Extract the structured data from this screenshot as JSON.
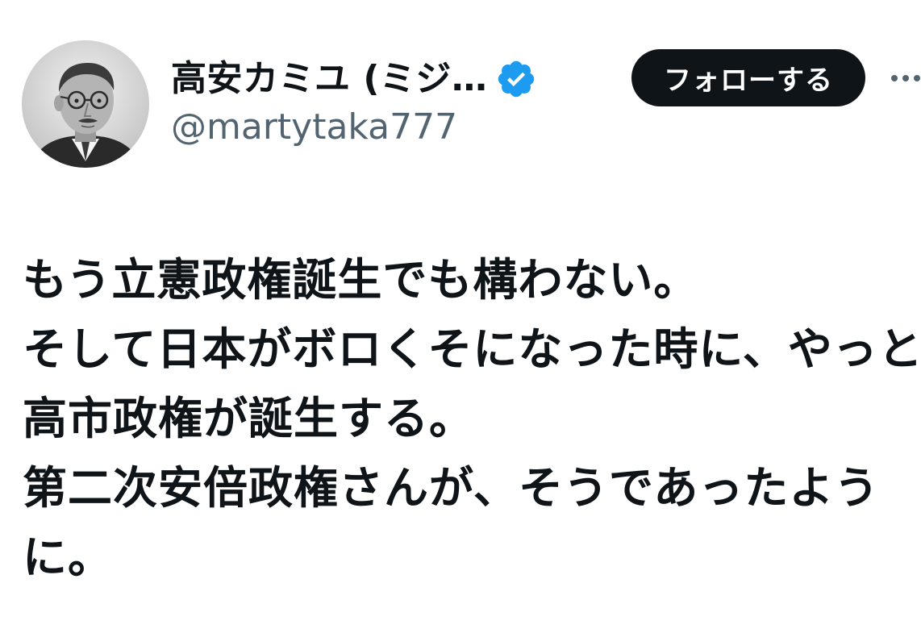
{
  "tweet": {
    "author": {
      "display_name": "高安カミユ (ミジ…",
      "handle": "@martytaka777",
      "verified": true,
      "avatar": "portrait-photo"
    },
    "follow_button_label": "フォローする",
    "more_icon": "more-horizontal-icon",
    "text_lines": [
      "もう立憲政権誕生でも構わない。",
      "そして日本がボロくそになった時に、やっと",
      "高市政権が誕生する。",
      "第二次安倍政権さんが、そうであったよう",
      "に。"
    ]
  },
  "colors": {
    "text": "#0f1419",
    "secondary_text": "#536471",
    "verified_badge": "#1d9bf0",
    "follow_button_bg": "#0f1419",
    "follow_button_text": "#ffffff"
  }
}
